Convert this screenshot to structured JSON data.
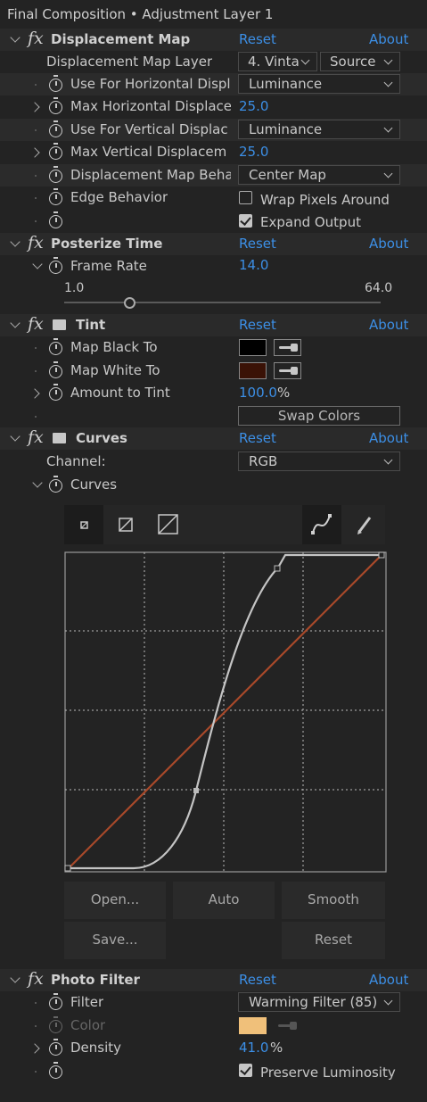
{
  "panel_title": "Final Composition • Adjustment Layer 1",
  "common": {
    "reset": "Reset",
    "about": "About"
  },
  "displacement": {
    "name": "Displacement Map",
    "map_layer_label": "Displacement Map Layer",
    "map_layer_value": "4. Vinta",
    "map_layer_source": "Source",
    "use_h_label": "Use For Horizontal Displ",
    "use_h_value": "Luminance",
    "max_h_label": "Max Horizontal Displace",
    "max_h_value": "25.0",
    "use_v_label": "Use For Vertical Displac",
    "use_v_value": "Luminance",
    "max_v_label": "Max Vertical Displacem",
    "max_v_value": "25.0",
    "behavior_label": "Displacement Map Beha",
    "behavior_value": "Center Map",
    "edge_label": "Edge Behavior",
    "wrap_label": "Wrap Pixels Around",
    "wrap_checked": false,
    "expand_label": "Expand Output",
    "expand_checked": true
  },
  "posterize": {
    "name": "Posterize Time",
    "frame_rate_label": "Frame Rate",
    "frame_rate_value": "14.0",
    "slider_min": "1.0",
    "slider_max": "64.0",
    "slider_fraction": 0.206
  },
  "tint": {
    "name": "Tint",
    "black_label": "Map Black To",
    "black_color": "#000000",
    "white_label": "Map White To",
    "white_color": "#3a1206",
    "amount_label": "Amount to Tint",
    "amount_value": "100.0",
    "amount_unit": "%",
    "swap_label": "Swap Colors"
  },
  "curves": {
    "name": "Curves",
    "channel_label": "Channel:",
    "channel_value": "RGB",
    "curves_label": "Curves",
    "btn_open": "Open...",
    "btn_auto": "Auto",
    "btn_smooth": "Smooth",
    "btn_save": "Save...",
    "btn_reset": "Reset",
    "rgb_curve_color": "#c4c4c4",
    "red_line_color": "#a8492a"
  },
  "photo_filter": {
    "name": "Photo Filter",
    "filter_label": "Filter",
    "filter_value": "Warming Filter (85)",
    "color_label": "Color",
    "color_value": "#f0c07a",
    "density_label": "Density",
    "density_value": "41.0",
    "density_unit": "%",
    "preserve_label": "Preserve Luminosity",
    "preserve_checked": true
  }
}
